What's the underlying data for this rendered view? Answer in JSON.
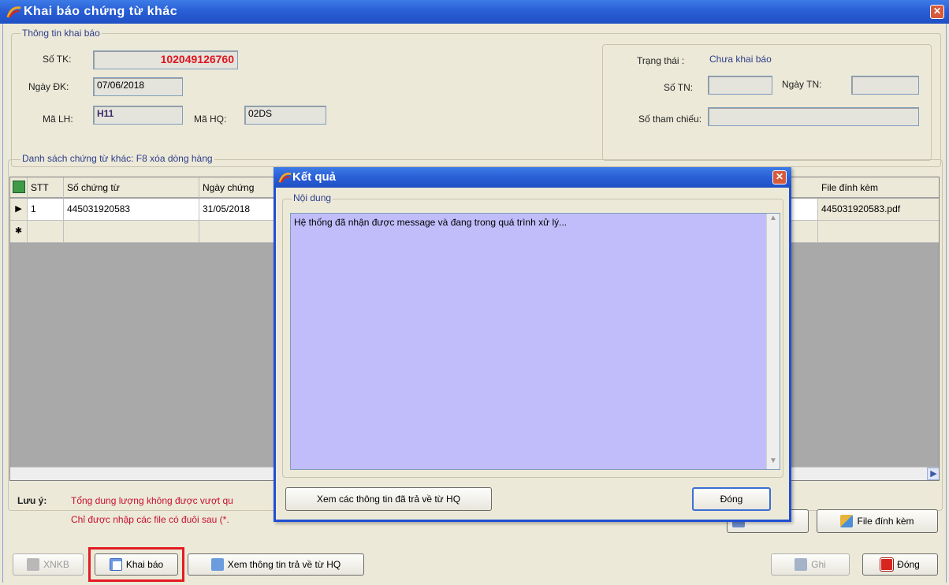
{
  "window": {
    "title": "Khai báo chứng từ khác",
    "close": "✕"
  },
  "info": {
    "group_label": "Thông tin khai báo",
    "so_tk_label": "Số TK:",
    "so_tk_value": "102049126760",
    "ngay_dk_label": "Ngày ĐK:",
    "ngay_dk_value": "07/06/2018",
    "ma_lh_label": "Mã LH:",
    "ma_lh_value": "H11",
    "ma_hq_label": "Mã HQ:",
    "ma_hq_value": "02DS",
    "trang_thai_label": "Trạng thái :",
    "trang_thai_value": "Chưa khai báo",
    "so_tn_label": "Số TN:",
    "so_tn_value": "",
    "ngay_tn_label": "Ngày TN:",
    "ngay_tn_value": "",
    "so_tham_chieu_label": "Số tham chiếu:",
    "so_tham_chieu_value": ""
  },
  "list": {
    "group_label": "Danh sách chứng từ khác: F8 xóa dòng hàng",
    "columns": {
      "stt": "STT",
      "so_chung_tu": "Số chứng từ",
      "ngay_chung_tu": "Ngày chứng",
      "file": "File đính kèm"
    },
    "rows": [
      {
        "marker": "▶",
        "stt": "1",
        "so_chung_tu": "445031920583",
        "ngay_chung_tu": "31/05/2018",
        "file": "445031920583.pdf"
      }
    ],
    "new_row_marker": "✱"
  },
  "note": {
    "label": "Lưu ý:",
    "line1": "Tổng dung lượng không được vượt qu",
    "line2": "Chỉ được nhập các file có đuôi sau (*."
  },
  "buttons": {
    "file_dinh_kem": "File đính kèm",
    "xnkb": "XNKB",
    "khai_bao": "Khai báo",
    "xem_thong_tin": "Xem thông tin trả về từ HQ",
    "ghi": "Ghi",
    "dong": "Đóng"
  },
  "modal": {
    "title": "Kết quả",
    "group_label": "Nội dung",
    "message": "Hệ thống đã nhận được message và đang trong quá trình xử lý...",
    "btn_xem": "Xem các thông tin đã trả về từ HQ",
    "btn_dong": "Đóng"
  },
  "colors": {
    "accent_red": "#e31b23",
    "title_blue": "#2a5fd6",
    "textarea_bg": "#c1bdfb",
    "value_red": "#e0151f"
  }
}
